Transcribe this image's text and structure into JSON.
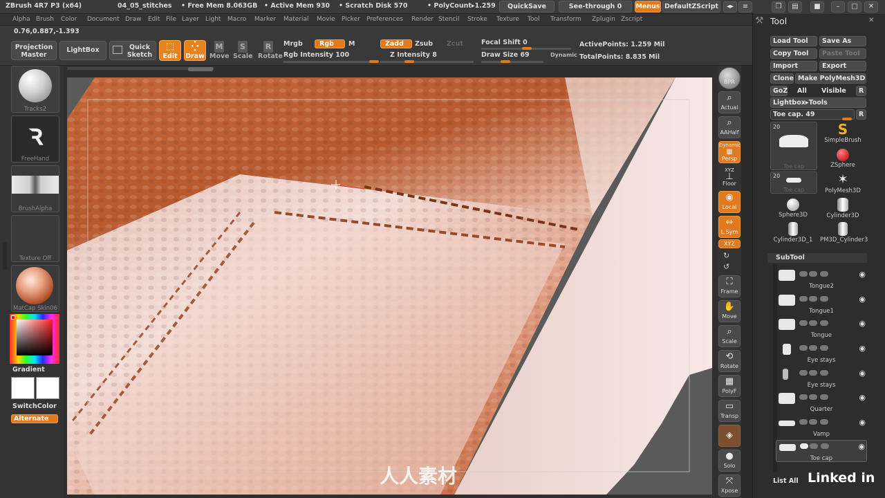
{
  "titlebar": {
    "app": "ZBrush 4R7 P3 (x64)",
    "doc": "04_05_stitches",
    "free_mem": "• Free Mem 8.063GB",
    "active_mem": "• Active Mem 930",
    "scratch": "• Scratch Disk 570",
    "polycount": "• PolyCount▸1.259",
    "quicksave": "QuickSave",
    "see_through": "See-through 0",
    "menus": "Menus",
    "default_script": "DefaultZScript"
  },
  "menubar": [
    "Alpha",
    "Brush",
    "Color",
    "Document",
    "Draw",
    "Edit",
    "File",
    "Layer",
    "Light",
    "Macro",
    "Marker",
    "Material",
    "Movie",
    "Picker",
    "Preferences",
    "Render",
    "Stencil",
    "Stroke",
    "Texture",
    "Tool",
    "Transform",
    "Zplugin",
    "Zscript"
  ],
  "coords": "0.76,0.887,-1.393",
  "shelf": {
    "projection_master": "Projection Master",
    "lightbox": "LightBox",
    "quick_sketch": "Quick Sketch",
    "edit": "Edit",
    "draw": "Draw",
    "move": "Move",
    "scale": "Scale",
    "rotate": "Rotate",
    "mrgb": "Mrgb",
    "rgb": "Rgb",
    "m": "M",
    "rgb_intensity": "Rgb Intensity 100",
    "zadd": "Zadd",
    "zsub": "Zsub",
    "zcut": "Zcut",
    "z_intensity": "Z Intensity 8",
    "focal_shift": "Focal Shift 0",
    "draw_size": "Draw Size 69",
    "dynamic": "Dynamic",
    "active_points": "ActivePoints: 1.259 Mil",
    "total_points": "TotalPoints: 8.835 Mil"
  },
  "leftbar": {
    "brush": "Tracks2",
    "stroke": "FreeHand",
    "alpha": "BrushAlpha",
    "texture": "Texture Off",
    "material": "MatCap Skin06",
    "gradient": "Gradient",
    "switch_color": "SwitchColor",
    "alternate": "Alternate"
  },
  "rightshelf": [
    "BPR",
    "Actual",
    "AAHalf",
    "Persp",
    "Floor",
    "Local",
    "L.Sym",
    "Frame",
    "Move",
    "Scale",
    "Rotate",
    "PolyF",
    "Transp",
    "Solo",
    "Xpose"
  ],
  "rightshelf_xyz": "XYZ",
  "rightshelf_dynamic": "Dynamic",
  "tool_palette": {
    "title": "Tool",
    "load_tool": "Load Tool",
    "save_as": "Save As",
    "copy_tool": "Copy Tool",
    "paste_tool": "Paste Tool",
    "import": "Import",
    "export": "Export",
    "clone": "Clone",
    "make_polymesh": "Make PolyMesh3D",
    "goz": "GoZ",
    "all": "All",
    "visible": "Visible",
    "r": "R",
    "lightbox_tools": "Lightbox▸Tools",
    "toe_cap": "Toe cap. 49",
    "tiles": [
      {
        "label": "Toe cap",
        "count": "20"
      },
      {
        "label": "SimpleBrush"
      },
      {
        "label": "ZSphere"
      },
      {
        "label": "Toe cap",
        "count": "20"
      },
      {
        "label": "PolyMesh3D"
      },
      {
        "label": "Sphere3D"
      },
      {
        "label": "Cylinder3D"
      },
      {
        "label": "Cylinder3D_1"
      },
      {
        "label": "PM3D_Cylinder3"
      }
    ],
    "subtool_title": "SubTool",
    "subtools": [
      "Tongue2",
      "Tongue1",
      "Tongue",
      "Eye stays",
      "Eye stays",
      "Quarter",
      "Vamp",
      "Toe cap"
    ],
    "list_all": "List All"
  },
  "watermark": "人人素材",
  "brand": "Linked in"
}
